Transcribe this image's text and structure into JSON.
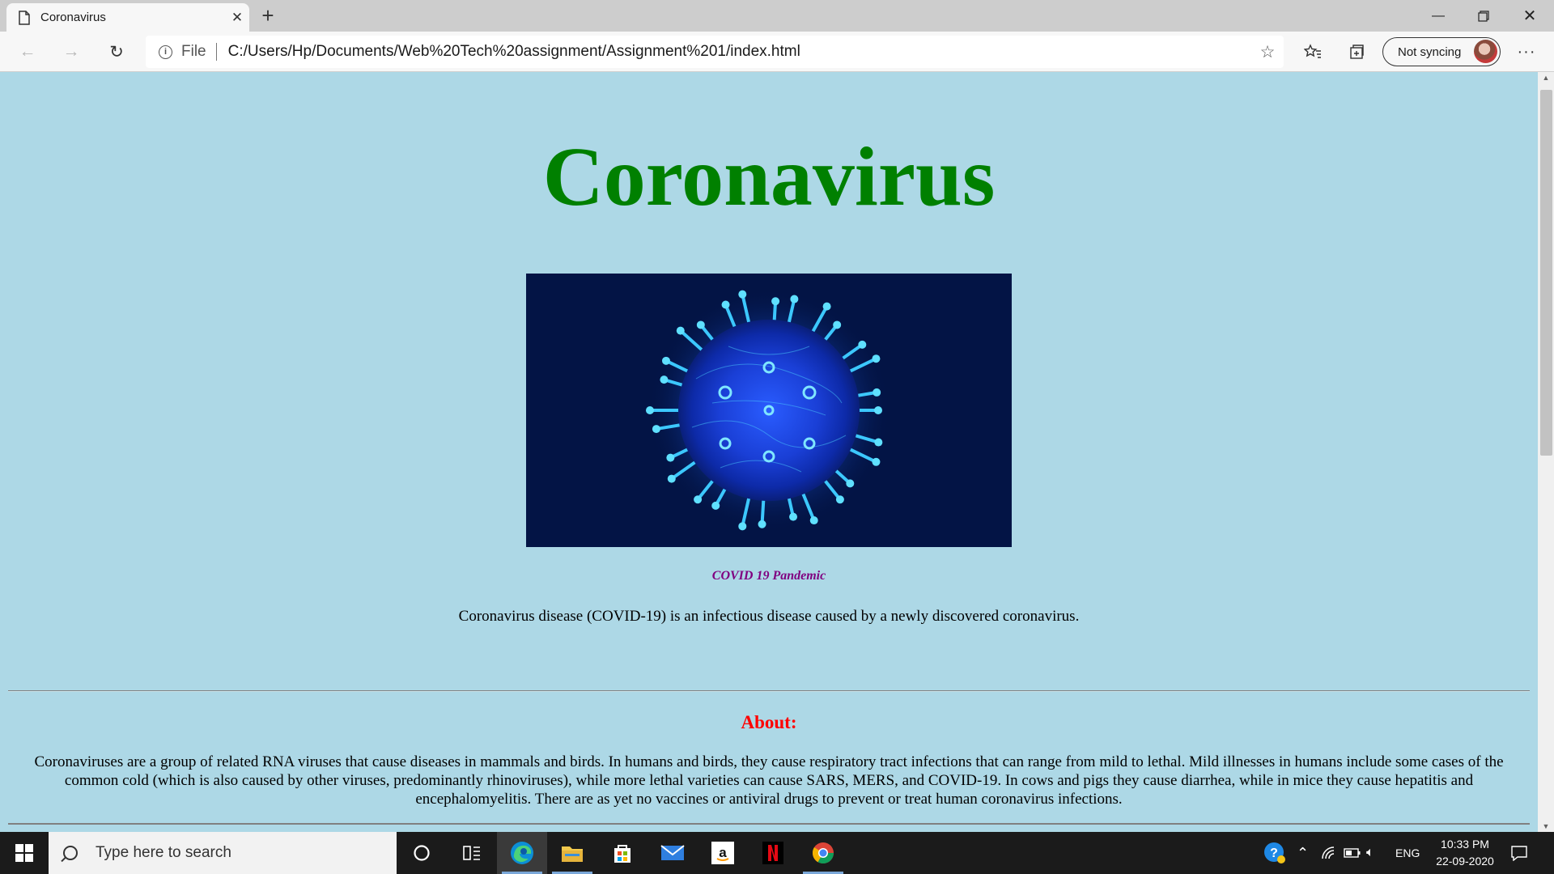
{
  "browser": {
    "tab_title": "Coronavirus",
    "url_scheme_label": "File",
    "url": "C:/Users/Hp/Documents/Web%20Tech%20assignment/Assignment%201/index.html",
    "sync_label": "Not syncing"
  },
  "page": {
    "title": "Coronavirus",
    "image_caption": "COVID 19 Pandemic",
    "intro": "Coronavirus disease (COVID-19) is an infectious disease caused by a newly discovered coronavirus.",
    "about_heading": "About:",
    "about_text": "Coronaviruses are a group of related RNA viruses that cause diseases in mammals and birds. In humans and birds, they cause respiratory tract infections that can range from mild to lethal. Mild illnesses in humans include some cases of the common cold (which is also caused by other viruses, predominantly rhinoviruses), while more lethal varieties can cause SARS, MERS, and COVID-19. In cows and pigs they cause diarrhea, while in mice they cause hepatitis and encephalomyelitis. There are as yet no vaccines or antiviral drugs to prevent or treat human coronavirus infections."
  },
  "taskbar": {
    "search_placeholder": "Type here to search",
    "apps": [
      "cortana-icon",
      "task-view-icon",
      "edge-icon",
      "file-explorer-icon",
      "store-icon",
      "mail-icon",
      "amazon-icon",
      "netflix-icon",
      "chrome-icon"
    ],
    "language": "ENG",
    "time": "10:33 PM",
    "date": "22-09-2020"
  },
  "colors": {
    "page_background": "#add8e6",
    "title": "#008000",
    "caption": "#800080",
    "about_heading": "#ff0000"
  }
}
